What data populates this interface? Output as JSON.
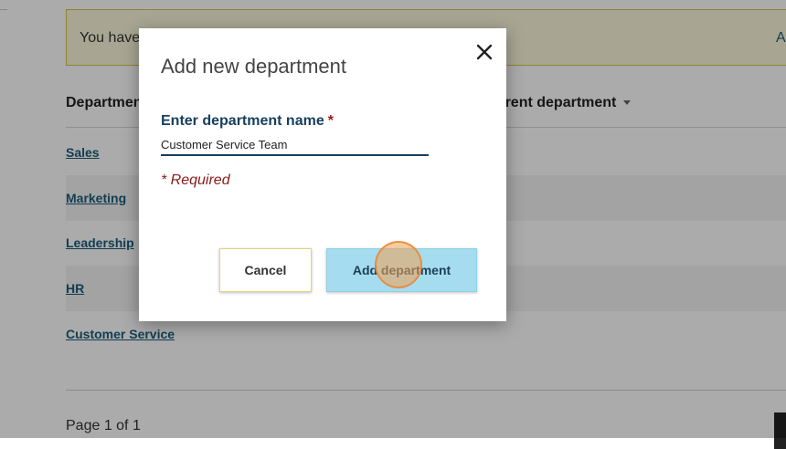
{
  "banner": {
    "text": "You have",
    "action": "A"
  },
  "table": {
    "columns": [
      {
        "label": "Department"
      },
      {
        "label": "Parent department"
      }
    ],
    "rows": [
      {
        "name": "Sales"
      },
      {
        "name": "Marketing"
      },
      {
        "name": "Leadership"
      },
      {
        "name": "HR"
      },
      {
        "name": "Customer Service"
      }
    ]
  },
  "pagination": {
    "label": "Page 1 of 1"
  },
  "modal": {
    "title": "Add new department",
    "field_label": "Enter department name",
    "required_marker": "*",
    "field_value": "Customer Service Team",
    "required_note": "* Required",
    "cancel_label": "Cancel",
    "submit_label": "Add department",
    "close_icon": "close-icon"
  },
  "colors": {
    "link": "#1c5d7a",
    "label": "#173e5c",
    "required": "#8b1a1a",
    "primary_button": "#a5dcef",
    "banner_bg": "#fbf8dc",
    "banner_border": "#d8c24a"
  }
}
